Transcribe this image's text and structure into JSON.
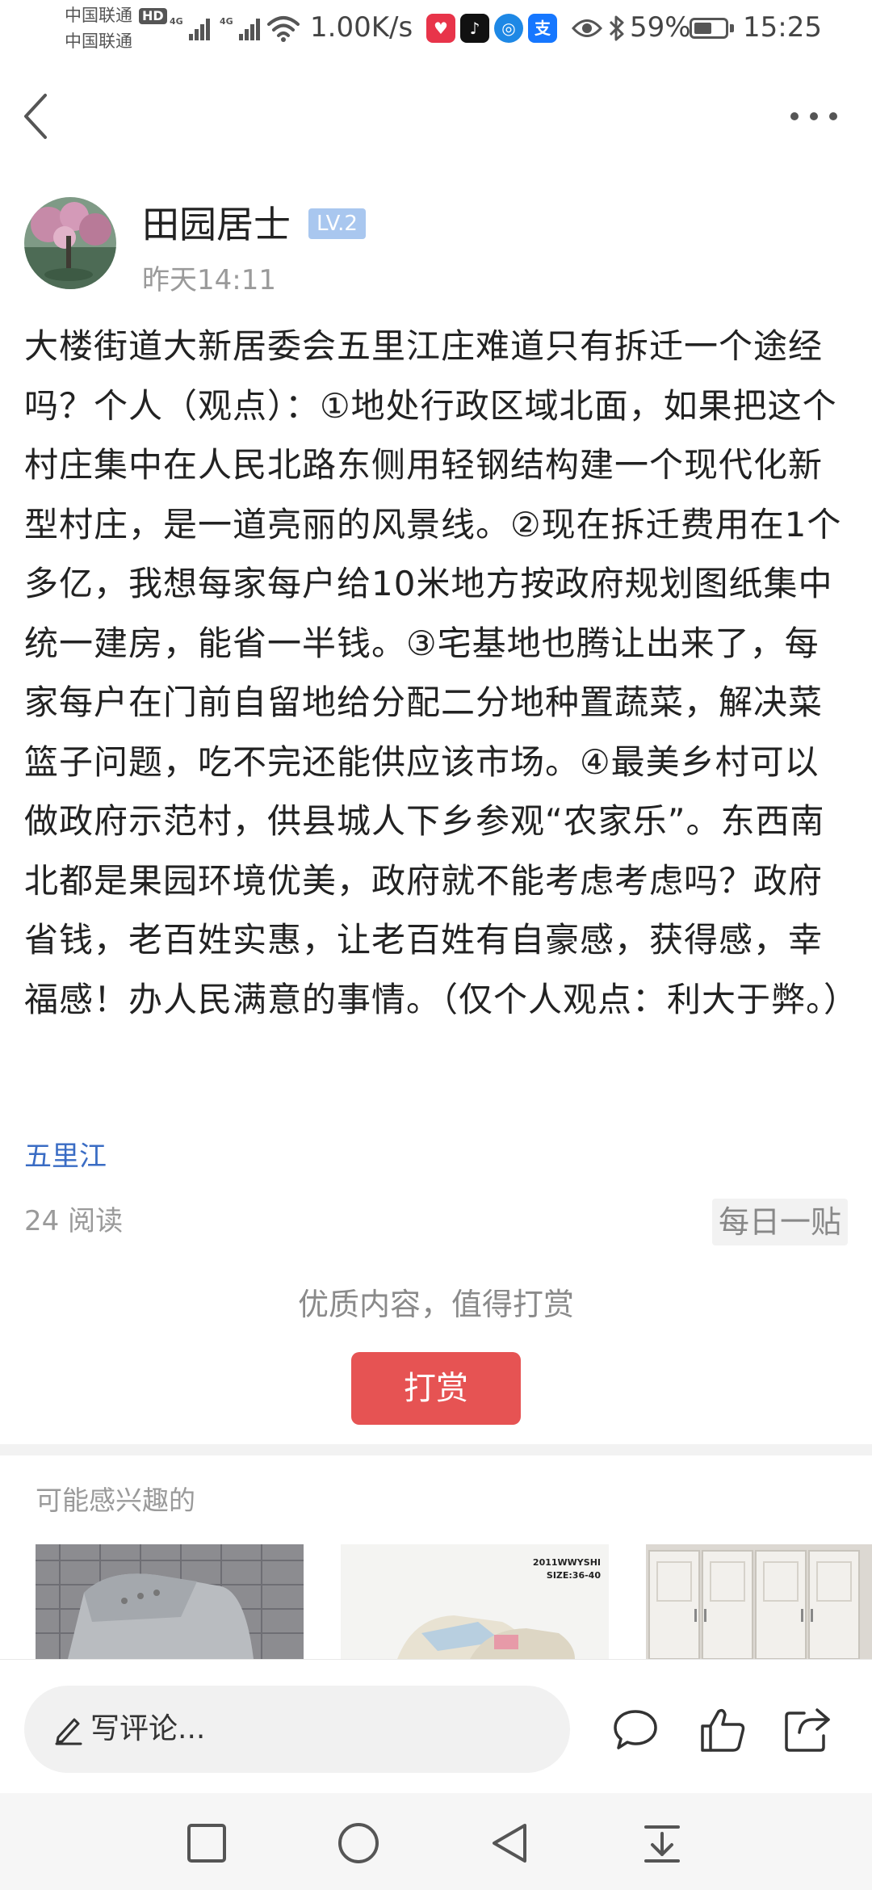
{
  "status_bar": {
    "carrier_1": "中国联通",
    "carrier_2": "中国联通",
    "hd": "HD",
    "network_type_1": "4G",
    "network_type_2": "4G",
    "net_speed": "1.00K/s",
    "battery_percent": "59%",
    "battery_level": 0.59,
    "time": "15:25",
    "app_icons": [
      "huawei-music-icon",
      "douyin-icon",
      "browser-icon",
      "alipay-icon"
    ]
  },
  "nav": {
    "back_icon": "chevron-left-icon",
    "more_icon": "more-horizontal-icon"
  },
  "author": {
    "name": "田园居士",
    "level": "LV.2",
    "time": "昨天14:11"
  },
  "post": {
    "body": "大楼街道大新居委会五里江庄难道只有拆迁一个途经吗？个人（观点）：①地处行政区域北面，如果把这个村庄集中在人民北路东侧用轻钢结构建一个现代化新型村庄，是一道亮丽的风景线。②现在拆迁费用在1个多亿，我想每家每户给10米地方按政府规划图纸集中统一建房，能省一半钱。③宅基地也腾让出来了，每家每户在门前自留地给分配二分地种置蔬菜，解决菜篮子问题，吃不完还能供应该市场。④最美乡村可以做政府示范村，供县城人下乡参观“农家乐”。东西南北都是果园环境优美，政府就不能考虑考虑吗？政府省钱，老百姓实惠，让老百姓有自豪感，获得感，幸福感！办人民满意的事情。（仅个人观点：利大于弊。）",
    "topic": "五里江",
    "read_count": "24 阅读",
    "daily_badge": "每日一贴"
  },
  "reward": {
    "prompt": "优质内容，值得打赏",
    "button": "打赏"
  },
  "recommendations": {
    "title": "可能感兴趣的",
    "cards": [
      {
        "caption": ""
      },
      {
        "caption": "2011WWYSHI\nSIZE:36-40"
      },
      {
        "caption": ""
      }
    ]
  },
  "comment_bar": {
    "placeholder": "写评论...",
    "icons": [
      "comment-bubble-icon",
      "thumbs-up-icon",
      "share-icon"
    ]
  },
  "system_nav": {
    "icons": [
      "recent-apps-square-icon",
      "home-circle-icon",
      "back-triangle-icon",
      "notification-pulldown-icon"
    ]
  }
}
